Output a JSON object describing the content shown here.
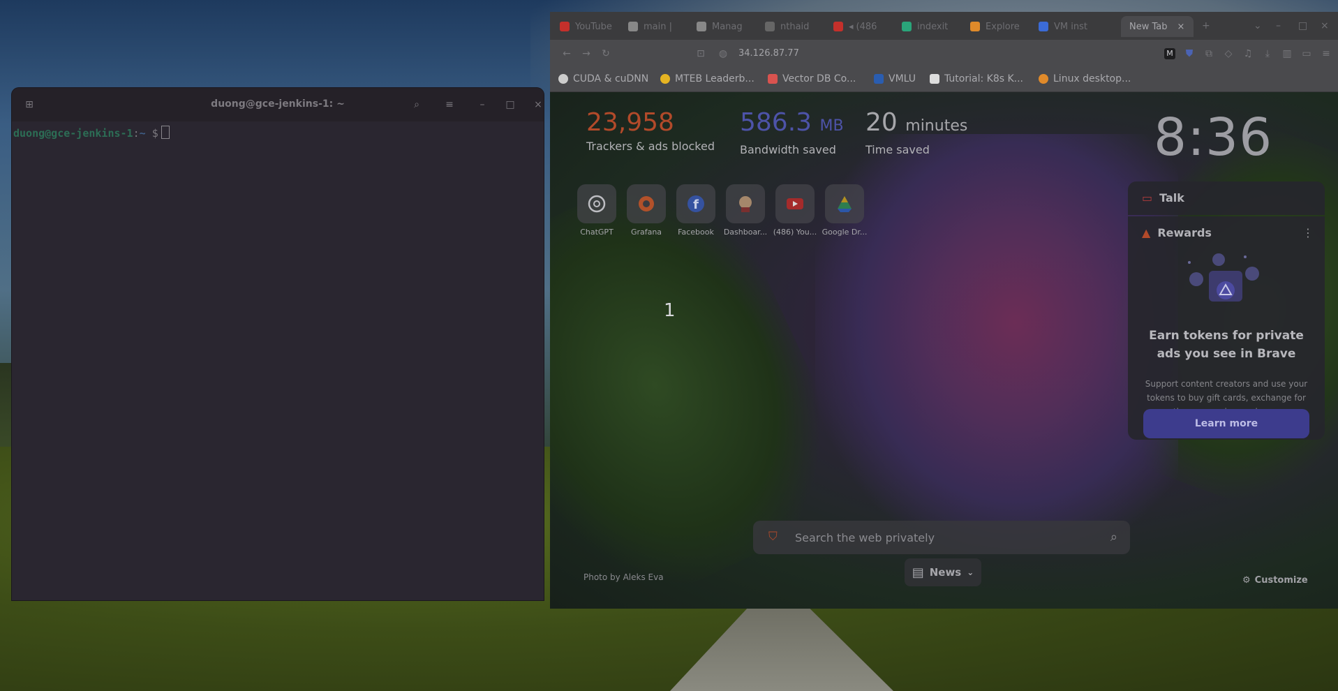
{
  "terminal": {
    "title": "duong@gce-jenkins-1: ~",
    "prompt_user": "duong@gce-jenkins-1",
    "prompt_sep": ":",
    "prompt_path": "~",
    "prompt_symbol": "$"
  },
  "browser": {
    "tabs": [
      {
        "label": "YouTube",
        "color": "#c4302b"
      },
      {
        "label": "main |",
        "color": "#888888"
      },
      {
        "label": "Manag",
        "color": "#888888"
      },
      {
        "label": "nthaid",
        "color": "#666666"
      },
      {
        "label": "(486",
        "color": "#c4302b"
      },
      {
        "label": "indexit",
        "color": "#2aa57a"
      },
      {
        "label": "Explore",
        "color": "#e08a2a"
      },
      {
        "label": "VM inst",
        "color": "#3b6bd6"
      },
      {
        "label": "New Tab",
        "color": ""
      }
    ],
    "url": "34.126.87.77",
    "bookmarks": [
      {
        "label": "CUDA & cuDNN",
        "color": "#cccccc"
      },
      {
        "label": "MTEB Leaderb...",
        "color": "#e6b422"
      },
      {
        "label": "Vector DB Co...",
        "color": "#d9534f"
      },
      {
        "label": "VMLU",
        "color": "#2a5db0"
      },
      {
        "label": "Tutorial: K8s K...",
        "color": "#dddddd"
      },
      {
        "label": "Linux desktop...",
        "color": "#e08a2a"
      }
    ]
  },
  "newtab": {
    "stats": [
      {
        "value": "23,958",
        "unit": "",
        "label": "Trackers & ads blocked",
        "color": "#b24a2a"
      },
      {
        "value": "586.3",
        "unit": "MB",
        "label": "Bandwidth saved",
        "color": "#4d53a8"
      },
      {
        "value": "20",
        "unit": "minutes",
        "label": "Time saved",
        "color": "#a7a7ab"
      }
    ],
    "clock": "8:36",
    "tiles": [
      {
        "label": "ChatGPT",
        "icon": "chatgpt-icon"
      },
      {
        "label": "Grafana",
        "icon": "grafana-icon"
      },
      {
        "label": "Facebook",
        "icon": "facebook-icon"
      },
      {
        "label": "Dashboar...",
        "icon": "jenkins-icon"
      },
      {
        "label": "(486) You...",
        "icon": "youtube-icon"
      },
      {
        "label": "Google Dr...",
        "icon": "google-drive-icon"
      }
    ],
    "overlay_number": "1",
    "talk_label": "Talk",
    "rewards": {
      "label": "Rewards",
      "title": "Earn tokens for private ads you see in Brave",
      "desc": "Support content creators and use your tokens to buy gift cards, exchange for other currencies, and more.",
      "button": "Learn more"
    },
    "search_placeholder": "Search the web privately",
    "photo_credit": "Photo by Aleks Eva",
    "news_label": "News",
    "customize_label": "Customize"
  }
}
